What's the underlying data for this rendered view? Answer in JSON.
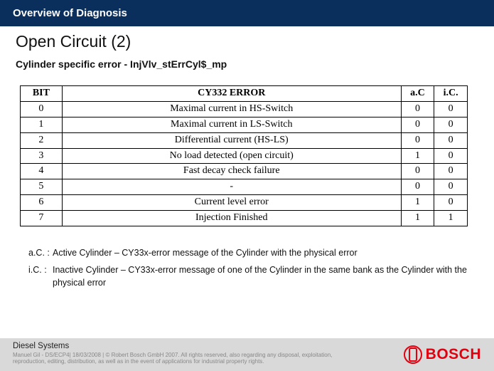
{
  "header": {
    "title": "Overview of Diagnosis"
  },
  "page": {
    "title": "Open Circuit (2)",
    "subtitle": "Cylinder specific error - InjVlv_stErrCyl$_mp"
  },
  "table": {
    "headers": {
      "bit": "BIT",
      "err": "CY332 ERROR",
      "ac": "a.C",
      "ic": "i.C."
    },
    "rows": [
      {
        "bit": "0",
        "err": "Maximal current in HS-Switch",
        "ac": "0",
        "ic": "0"
      },
      {
        "bit": "1",
        "err": "Maximal current in LS-Switch",
        "ac": "0",
        "ic": "0"
      },
      {
        "bit": "2",
        "err": "Differential current (HS-LS)",
        "ac": "0",
        "ic": "0"
      },
      {
        "bit": "3",
        "err": "No load detected (open circuit)",
        "ac": "1",
        "ic": "0"
      },
      {
        "bit": "4",
        "err": "Fast decay check failure",
        "ac": "0",
        "ic": "0"
      },
      {
        "bit": "5",
        "err": "-",
        "ac": "0",
        "ic": "0"
      },
      {
        "bit": "6",
        "err": "Current level error",
        "ac": "1",
        "ic": "0"
      },
      {
        "bit": "7",
        "err": "Injection Finished",
        "ac": "1",
        "ic": "1"
      }
    ]
  },
  "legend": {
    "ac": {
      "key": "a.C. :",
      "text": "Active Cylinder – CY33x-error message of the Cylinder with the physical error"
    },
    "ic": {
      "key": "i.C. :",
      "text": "Inactive Cylinder – CY33x-error message of one of the Cylinder in the same bank as the Cylinder with the physical error"
    }
  },
  "footer": {
    "dept": "Diesel Systems",
    "legal": "Manuel Gil - DS/ECP4| 18/03/2008 | © Robert Bosch GmbH 2007. All rights reserved, also regarding any disposal, exploitation, reproduction, editing, distribution, as well as in the event of applications for industrial property rights.",
    "logo": "BOSCH"
  }
}
